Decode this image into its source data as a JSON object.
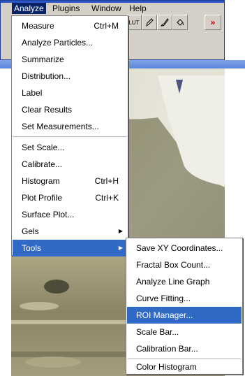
{
  "menubar": {
    "items": [
      {
        "label": "Analyze",
        "active": true
      },
      {
        "label": "Plugins",
        "active": false
      },
      {
        "label": "Window",
        "active": false
      },
      {
        "label": "Help",
        "active": false
      }
    ]
  },
  "toolbar": {
    "lut_label": "LUT",
    "more_label": "»",
    "tools": [
      "lut-icon",
      "pencil-icon",
      "brush-icon",
      "flood-fill-icon",
      "more-tools-icon"
    ]
  },
  "analyze_menu": {
    "items": [
      {
        "label": "Measure",
        "shortcut": "Ctrl+M"
      },
      {
        "label": "Analyze Particles..."
      },
      {
        "label": "Summarize"
      },
      {
        "label": "Distribution..."
      },
      {
        "label": "Label"
      },
      {
        "label": "Clear Results"
      },
      {
        "label": "Set Measurements..."
      },
      {
        "label": "Set Scale..."
      },
      {
        "label": "Calibrate..."
      },
      {
        "label": "Histogram",
        "shortcut": "Ctrl+H"
      },
      {
        "label": "Plot Profile",
        "shortcut": "Ctrl+K"
      },
      {
        "label": "Surface Plot..."
      },
      {
        "label": "Gels",
        "submenu": true
      },
      {
        "label": "Tools",
        "submenu": true,
        "highlighted": true
      }
    ]
  },
  "tools_submenu": {
    "items": [
      {
        "label": "Save XY Coordinates..."
      },
      {
        "label": "Fractal Box Count..."
      },
      {
        "label": "Analyze Line Graph"
      },
      {
        "label": "Curve Fitting..."
      },
      {
        "label": "ROI Manager...",
        "highlighted": true
      },
      {
        "label": "Scale Bar..."
      },
      {
        "label": "Calibration Bar..."
      },
      {
        "label": "Color Histogram"
      }
    ]
  },
  "colors": {
    "menu_highlight": "#316ac5",
    "menubar_active": "#0a246a",
    "window_chrome": "#d4d0c8",
    "title_blue": "#2a56c6"
  }
}
